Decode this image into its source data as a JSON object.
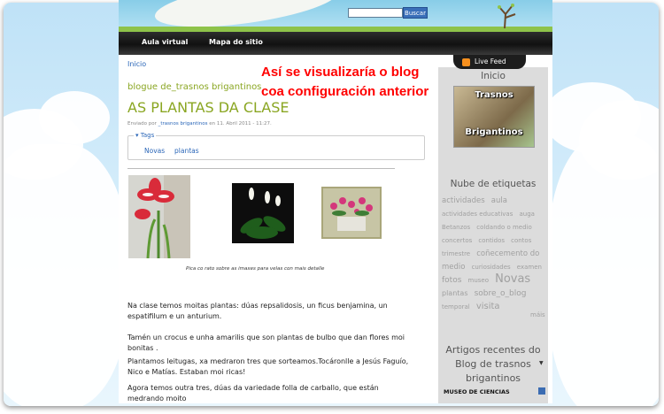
{
  "header": {
    "search_placeholder": "",
    "search_button": "Buscar"
  },
  "nav": {
    "items": [
      "Aula virtual",
      "Mapa do sitio"
    ]
  },
  "breadcrumb": "Inicio",
  "post": {
    "blog_name": "blogue de_trasnos brigantinos",
    "title": "AS PLANTAS DA CLASE",
    "meta_prefix": "Enviado por",
    "author": "_trasnos brigantinos",
    "date": "en 11. Abril 2011 - 11:27.",
    "tags_label": "Tags",
    "tags": [
      "Novas",
      "plantas"
    ],
    "caption": "Pica co rato sobre as imaxes para velas con mais detalle",
    "paragraphs": [
      "Na clase temos moitas plantas: dúas repsalidosis, un ficus benjamina, un espatifilum e un anturium.",
      "Tamén un crocus e unha amarilis que son plantas de bulbo que dan flores moi bonitas .",
      "Plantamos leitugas, xa medraron tres que sorteamos.Tocáronlle a Jesús Faguío, Nico e Matías. Estaban moi ricas!",
      "Agora temos outra tres, dúas da variedade folla de carballo, que están medrando moito"
    ]
  },
  "overlay_note": {
    "line1": "Así se visualizaría o blog",
    "line2": "coa configuración anterior"
  },
  "sidebar": {
    "live_feed": "Live Feed",
    "home_heading": "Inicio",
    "badge_top": "Trasnos",
    "badge_bottom": "Brigantinos",
    "tag_cloud_heading": "Nube de etiquetas",
    "tag_cloud": [
      {
        "text": "actividades",
        "size": 8.5
      },
      {
        "text": "aula",
        "size": 8.5
      },
      {
        "text": "actividades educativas",
        "size": 7
      },
      {
        "text": "auga",
        "size": 7
      },
      {
        "text": "Betanzos",
        "size": 7
      },
      {
        "text": "coldando o medio",
        "size": 7
      },
      {
        "text": "concertos",
        "size": 7
      },
      {
        "text": "contidos",
        "size": 7
      },
      {
        "text": "contos",
        "size": 7
      },
      {
        "text": "trimestre",
        "size": 7
      },
      {
        "text": "coñecemento do medio",
        "size": 8.5
      },
      {
        "text": "curiosidades",
        "size": 7
      },
      {
        "text": "examen",
        "size": 7
      },
      {
        "text": "fotos",
        "size": 9
      },
      {
        "text": "museo",
        "size": 7
      },
      {
        "text": "Novas",
        "size": 13
      },
      {
        "text": "plantas",
        "size": 8
      },
      {
        "text": "sobre_o_blog",
        "size": 9
      },
      {
        "text": "temporal",
        "size": 7
      },
      {
        "text": "visita",
        "size": 10
      }
    ],
    "more_link": "máis",
    "recent_heading": "Artigos recentes do Blog de trasnos brigantinos",
    "recent_item": "MUSEO DE CIENCIAS"
  },
  "colors": {
    "accent_green": "#8aa622",
    "link_blue": "#2a66b8",
    "annotation_red": "#ff0000"
  }
}
